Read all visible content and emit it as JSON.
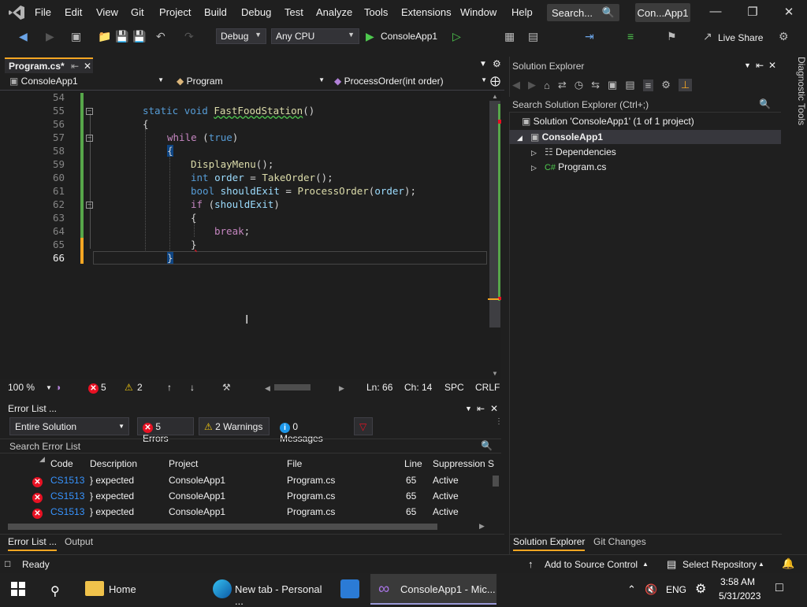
{
  "menubar": {
    "items": [
      "File",
      "Edit",
      "View",
      "Git",
      "Project",
      "Build",
      "Debug",
      "Test",
      "Analyze",
      "Tools",
      "Extensions",
      "Window",
      "Help"
    ],
    "search_label": "Search...",
    "solution_name": "Con...App1"
  },
  "toolbar": {
    "config": "Debug",
    "platform": "Any CPU",
    "run_target": "ConsoleApp1",
    "live_share": "Live Share"
  },
  "doc_tab": {
    "label": "Program.cs*"
  },
  "nav": {
    "project": "ConsoleApp1",
    "class": "Program",
    "member": "ProcessOrder(int order)"
  },
  "editor": {
    "line_numbers": [
      "54",
      "55",
      "56",
      "57",
      "58",
      "59",
      "60",
      "61",
      "62",
      "63",
      "64",
      "65",
      "66"
    ],
    "lines": {
      "l55_kw1": "static ",
      "l55_kw2": "void ",
      "l55_fn": "FastFoodStation",
      "l55_p": "()",
      "l56": "{",
      "l57_kw": "while ",
      "l57_p1": "(",
      "l57_kw2": "true",
      "l57_p2": ")",
      "l58": "{",
      "l59_fn": "DisplayMenu",
      "l59_p": "();",
      "l60_kw": "int ",
      "l60_id": "order",
      "l60_p": " = ",
      "l60_fn": "TakeOrder",
      "l60_p2": "();",
      "l61_kw": "bool ",
      "l61_id": "shouldExit",
      "l61_p": " = ",
      "l61_fn": "ProcessOrder",
      "l61_p2": "(",
      "l61_id2": "order",
      "l61_p3": ");",
      "l62_kw": "if ",
      "l62_p1": "(",
      "l62_id": "shouldExit",
      "l62_p2": ")",
      "l63": "{",
      "l64_kw": "break",
      "l64_p": ";",
      "l65": "}",
      "l66": "}"
    }
  },
  "editor_status": {
    "zoom": "100 %",
    "errors": "5",
    "warnings": "2",
    "ln": "Ln: 66",
    "ch": "Ch: 14",
    "spc": "SPC",
    "crlf": "CRLF"
  },
  "error_list": {
    "title": "Error List ...",
    "scope": "Entire Solution",
    "errors_btn": "5 Errors",
    "warnings_btn": "2 Warnings",
    "messages_btn": "0 Messages",
    "search_placeholder": "Search Error List",
    "columns": [
      "Code",
      "Description",
      "Project",
      "File",
      "Line",
      "Suppression S"
    ],
    "rows": [
      {
        "code": "CS1513",
        "desc": "} expected",
        "project": "ConsoleApp1",
        "file": "Program.cs",
        "line": "65",
        "supp": "Active"
      },
      {
        "code": "CS1513",
        "desc": "} expected",
        "project": "ConsoleApp1",
        "file": "Program.cs",
        "line": "65",
        "supp": "Active"
      },
      {
        "code": "CS1513",
        "desc": "} expected",
        "project": "ConsoleApp1",
        "file": "Program.cs",
        "line": "65",
        "supp": "Active"
      }
    ]
  },
  "bottom_tabs": {
    "error_list": "Error List ...",
    "output": "Output"
  },
  "solution_explorer": {
    "title": "Solution Explorer",
    "search_placeholder": "Search Solution Explorer (Ctrl+;)",
    "solution": "Solution 'ConsoleApp1' (1 of 1 project)",
    "project": "ConsoleApp1",
    "dependencies": "Dependencies",
    "file": "Program.cs",
    "tab_sol": "Solution Explorer",
    "tab_git": "Git Changes",
    "side_tool": "Diagnostic Tools"
  },
  "statusbar": {
    "ready": "Ready",
    "source_control": "Add to Source Control",
    "repo": "Select Repository"
  },
  "taskbar": {
    "home": "Home",
    "edge": "New tab - Personal ...",
    "vs": "ConsoleApp1 - Mic...",
    "lang": "ENG",
    "time": "3:58 AM",
    "date": "5/31/2023"
  },
  "colors": {
    "accent": "#f5a623",
    "error": "#e81123",
    "warning": "#f2c80f",
    "keyword": "#569cd6"
  }
}
